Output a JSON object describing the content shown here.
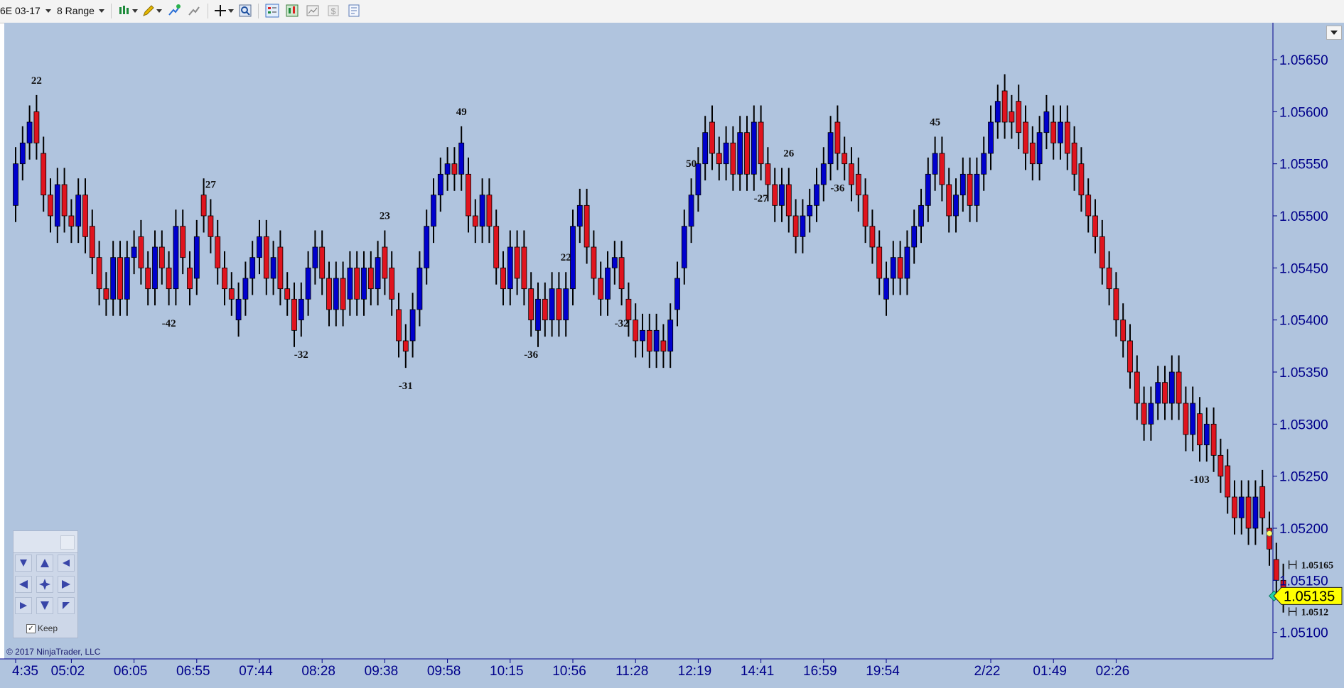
{
  "toolbar": {
    "instrument": "6E 03-17",
    "bar_type": "8 Range",
    "icons": [
      "bar-style-icon",
      "drawing-tools-icon",
      "add-indicator-icon",
      "strategies-icon",
      "crosshair-icon",
      "zoom-icon",
      "chart-trader-icon",
      "data-box-icon",
      "templates-icon",
      "dollar-icon",
      "properties-icon"
    ]
  },
  "chart": {
    "colors": {
      "background": "#b0c4de",
      "up_bar": "#0000cd",
      "down_bar": "#e0141e",
      "wick": "#000000",
      "axis": "#00008b",
      "price_marker": "#ffff00"
    },
    "price_axis": {
      "min": 1.0508,
      "max": 1.0568,
      "ticks": [
        "1.05650",
        "1.05600",
        "1.05550",
        "1.05500",
        "1.05450",
        "1.05400",
        "1.05350",
        "1.05300",
        "1.05250",
        "1.05200",
        "1.05150",
        "1.05100"
      ]
    },
    "time_axis": {
      "labels": [
        {
          "label": "4:35",
          "bar": 0
        },
        {
          "label": "05:02",
          "bar": 8
        },
        {
          "label": "06:05",
          "bar": 17
        },
        {
          "label": "06:55",
          "bar": 26
        },
        {
          "label": "07:44",
          "bar": 35
        },
        {
          "label": "08:28",
          "bar": 44
        },
        {
          "label": "09:38",
          "bar": 53
        },
        {
          "label": "09:58",
          "bar": 62
        },
        {
          "label": "10:15",
          "bar": 71
        },
        {
          "label": "10:56",
          "bar": 80
        },
        {
          "label": "11:28",
          "bar": 89
        },
        {
          "label": "12:19",
          "bar": 98
        },
        {
          "label": "14:41",
          "bar": 107
        },
        {
          "label": "16:59",
          "bar": 116
        },
        {
          "label": "19:54",
          "bar": 125
        },
        {
          "label": "2/22",
          "bar": 140
        },
        {
          "label": "01:49",
          "bar": 149
        },
        {
          "label": "02:26",
          "bar": 158
        }
      ]
    },
    "bars": [
      {
        "o": 1.0551,
        "c": 1.0555
      },
      {
        "o": 1.0555,
        "c": 1.0557
      },
      {
        "o": 1.0557,
        "c": 1.0559
      },
      {
        "o": 1.056,
        "c": 1.0557
      },
      {
        "o": 1.0556,
        "c": 1.0552
      },
      {
        "o": 1.0552,
        "c": 1.055
      },
      {
        "o": 1.0549,
        "c": 1.0553
      },
      {
        "o": 1.0553,
        "c": 1.055
      },
      {
        "o": 1.055,
        "c": 1.0549
      },
      {
        "o": 1.0549,
        "c": 1.0552
      },
      {
        "o": 1.0552,
        "c": 1.0548
      },
      {
        "o": 1.0549,
        "c": 1.0546
      },
      {
        "o": 1.0546,
        "c": 1.0543
      },
      {
        "o": 1.0543,
        "c": 1.0542
      },
      {
        "o": 1.0542,
        "c": 1.0546
      },
      {
        "o": 1.0546,
        "c": 1.0542
      },
      {
        "o": 1.0542,
        "c": 1.0546
      },
      {
        "o": 1.0546,
        "c": 1.0547
      },
      {
        "o": 1.0548,
        "c": 1.0545
      },
      {
        "o": 1.0545,
        "c": 1.0543
      },
      {
        "o": 1.0543,
        "c": 1.0547
      },
      {
        "o": 1.0547,
        "c": 1.0545
      },
      {
        "o": 1.0545,
        "c": 1.0543
      },
      {
        "o": 1.0543,
        "c": 1.0549
      },
      {
        "o": 1.0549,
        "c": 1.0546
      },
      {
        "o": 1.0545,
        "c": 1.0543
      },
      {
        "o": 1.0544,
        "c": 1.0548
      },
      {
        "o": 1.0552,
        "c": 1.055
      },
      {
        "o": 1.055,
        "c": 1.0548
      },
      {
        "o": 1.0548,
        "c": 1.0545
      },
      {
        "o": 1.0545,
        "c": 1.0543
      },
      {
        "o": 1.0543,
        "c": 1.0542
      },
      {
        "o": 1.054,
        "c": 1.0542
      },
      {
        "o": 1.0542,
        "c": 1.0544
      },
      {
        "o": 1.0544,
        "c": 1.0546
      },
      {
        "o": 1.0546,
        "c": 1.0548
      },
      {
        "o": 1.0548,
        "c": 1.0544
      },
      {
        "o": 1.0544,
        "c": 1.0546
      },
      {
        "o": 1.0547,
        "c": 1.0543
      },
      {
        "o": 1.0543,
        "c": 1.0542
      },
      {
        "o": 1.0542,
        "c": 1.0539
      },
      {
        "o": 1.054,
        "c": 1.0542
      },
      {
        "o": 1.0542,
        "c": 1.0545
      },
      {
        "o": 1.0545,
        "c": 1.0547
      },
      {
        "o": 1.0547,
        "c": 1.0544
      },
      {
        "o": 1.0544,
        "c": 1.0541
      },
      {
        "o": 1.0541,
        "c": 1.0544
      },
      {
        "o": 1.0544,
        "c": 1.0541
      },
      {
        "o": 1.0542,
        "c": 1.0545
      },
      {
        "o": 1.0545,
        "c": 1.0542
      },
      {
        "o": 1.0542,
        "c": 1.0545
      },
      {
        "o": 1.0545,
        "c": 1.0543
      },
      {
        "o": 1.0543,
        "c": 1.0546
      },
      {
        "o": 1.0547,
        "c": 1.0544
      },
      {
        "o": 1.0545,
        "c": 1.0542
      },
      {
        "o": 1.0541,
        "c": 1.0538
      },
      {
        "o": 1.0538,
        "c": 1.0537
      },
      {
        "o": 1.0538,
        "c": 1.0541
      },
      {
        "o": 1.0541,
        "c": 1.0545
      },
      {
        "o": 1.0545,
        "c": 1.0549
      },
      {
        "o": 1.0549,
        "c": 1.0552
      },
      {
        "o": 1.0552,
        "c": 1.0554
      },
      {
        "o": 1.0554,
        "c": 1.0555
      },
      {
        "o": 1.0555,
        "c": 1.0554
      },
      {
        "o": 1.0554,
        "c": 1.0557
      },
      {
        "o": 1.0554,
        "c": 1.055
      },
      {
        "o": 1.055,
        "c": 1.0549
      },
      {
        "o": 1.0549,
        "c": 1.0552
      },
      {
        "o": 1.0552,
        "c": 1.0549
      },
      {
        "o": 1.0549,
        "c": 1.0545
      },
      {
        "o": 1.0545,
        "c": 1.0543
      },
      {
        "o": 1.0543,
        "c": 1.0547
      },
      {
        "o": 1.0547,
        "c": 1.0544
      },
      {
        "o": 1.0547,
        "c": 1.0543
      },
      {
        "o": 1.0543,
        "c": 1.054
      },
      {
        "o": 1.0539,
        "c": 1.0542
      },
      {
        "o": 1.0542,
        "c": 1.054
      },
      {
        "o": 1.054,
        "c": 1.0543
      },
      {
        "o": 1.0543,
        "c": 1.054
      },
      {
        "o": 1.054,
        "c": 1.0543
      },
      {
        "o": 1.0543,
        "c": 1.0549
      },
      {
        "o": 1.0549,
        "c": 1.0551
      },
      {
        "o": 1.0551,
        "c": 1.0547
      },
      {
        "o": 1.0547,
        "c": 1.0544
      },
      {
        "o": 1.0544,
        "c": 1.0542
      },
      {
        "o": 1.0542,
        "c": 1.0545
      },
      {
        "o": 1.0545,
        "c": 1.0546
      },
      {
        "o": 1.0546,
        "c": 1.0543
      },
      {
        "o": 1.0542,
        "c": 1.054
      },
      {
        "o": 1.054,
        "c": 1.0538
      },
      {
        "o": 1.0538,
        "c": 1.0539
      },
      {
        "o": 1.0539,
        "c": 1.0537
      },
      {
        "o": 1.0537,
        "c": 1.0539
      },
      {
        "o": 1.0538,
        "c": 1.0537
      },
      {
        "o": 1.0537,
        "c": 1.054
      },
      {
        "o": 1.0541,
        "c": 1.0544
      },
      {
        "o": 1.0545,
        "c": 1.0549
      },
      {
        "o": 1.0549,
        "c": 1.0552
      },
      {
        "o": 1.0552,
        "c": 1.0555
      },
      {
        "o": 1.0555,
        "c": 1.0558
      },
      {
        "o": 1.0559,
        "c": 1.0556
      },
      {
        "o": 1.0556,
        "c": 1.0555
      },
      {
        "o": 1.0555,
        "c": 1.0557
      },
      {
        "o": 1.0557,
        "c": 1.0554
      },
      {
        "o": 1.0554,
        "c": 1.0558
      },
      {
        "o": 1.0558,
        "c": 1.0554
      },
      {
        "o": 1.0554,
        "c": 1.0559
      },
      {
        "o": 1.0559,
        "c": 1.0555
      },
      {
        "o": 1.0555,
        "c": 1.0553
      },
      {
        "o": 1.0553,
        "c": 1.0551
      },
      {
        "o": 1.0551,
        "c": 1.0553
      },
      {
        "o": 1.0553,
        "c": 1.055
      },
      {
        "o": 1.055,
        "c": 1.0548
      },
      {
        "o": 1.0548,
        "c": 1.055
      },
      {
        "o": 1.055,
        "c": 1.0551
      },
      {
        "o": 1.0551,
        "c": 1.0553
      },
      {
        "o": 1.0553,
        "c": 1.0555
      },
      {
        "o": 1.0555,
        "c": 1.0558
      },
      {
        "o": 1.0559,
        "c": 1.0556
      },
      {
        "o": 1.0556,
        "c": 1.0555
      },
      {
        "o": 1.0555,
        "c": 1.0553
      },
      {
        "o": 1.0554,
        "c": 1.0552
      },
      {
        "o": 1.0552,
        "c": 1.0549
      },
      {
        "o": 1.0549,
        "c": 1.0547
      },
      {
        "o": 1.0547,
        "c": 1.0544
      },
      {
        "o": 1.0542,
        "c": 1.0544
      },
      {
        "o": 1.0544,
        "c": 1.0546
      },
      {
        "o": 1.0546,
        "c": 1.0544
      },
      {
        "o": 1.0544,
        "c": 1.0547
      },
      {
        "o": 1.0547,
        "c": 1.0549
      },
      {
        "o": 1.0549,
        "c": 1.0551
      },
      {
        "o": 1.0551,
        "c": 1.0554
      },
      {
        "o": 1.0554,
        "c": 1.0556
      },
      {
        "o": 1.0556,
        "c": 1.0553
      },
      {
        "o": 1.0553,
        "c": 1.055
      },
      {
        "o": 1.055,
        "c": 1.0552
      },
      {
        "o": 1.0552,
        "c": 1.0554
      },
      {
        "o": 1.0554,
        "c": 1.0551
      },
      {
        "o": 1.0551,
        "c": 1.0554
      },
      {
        "o": 1.0554,
        "c": 1.0556
      },
      {
        "o": 1.0556,
        "c": 1.0559
      },
      {
        "o": 1.0559,
        "c": 1.0561
      },
      {
        "o": 1.0562,
        "c": 1.0559
      },
      {
        "o": 1.056,
        "c": 1.0559
      },
      {
        "o": 1.0561,
        "c": 1.0558
      },
      {
        "o": 1.0559,
        "c": 1.0556
      },
      {
        "o": 1.0557,
        "c": 1.0555
      },
      {
        "o": 1.0555,
        "c": 1.0558
      },
      {
        "o": 1.0558,
        "c": 1.056
      },
      {
        "o": 1.0559,
        "c": 1.0557
      },
      {
        "o": 1.0557,
        "c": 1.0559
      },
      {
        "o": 1.0559,
        "c": 1.0556
      },
      {
        "o": 1.0557,
        "c": 1.0554
      },
      {
        "o": 1.0555,
        "c": 1.0552
      },
      {
        "o": 1.0552,
        "c": 1.055
      },
      {
        "o": 1.055,
        "c": 1.0548
      },
      {
        "o": 1.0548,
        "c": 1.0545
      },
      {
        "o": 1.0545,
        "c": 1.0543
      },
      {
        "o": 1.0543,
        "c": 1.054
      },
      {
        "o": 1.054,
        "c": 1.0538
      },
      {
        "o": 1.0538,
        "c": 1.0535
      },
      {
        "o": 1.0535,
        "c": 1.0532
      },
      {
        "o": 1.0532,
        "c": 1.053
      },
      {
        "o": 1.053,
        "c": 1.0532
      },
      {
        "o": 1.0532,
        "c": 1.0534
      },
      {
        "o": 1.0534,
        "c": 1.0532
      },
      {
        "o": 1.0532,
        "c": 1.0535
      },
      {
        "o": 1.0535,
        "c": 1.0532
      },
      {
        "o": 1.0532,
        "c": 1.0529
      },
      {
        "o": 1.0529,
        "c": 1.0532
      },
      {
        "o": 1.0531,
        "c": 1.0528
      },
      {
        "o": 1.0528,
        "c": 1.053
      },
      {
        "o": 1.053,
        "c": 1.0527
      },
      {
        "o": 1.0527,
        "c": 1.0525
      },
      {
        "o": 1.0526,
        "c": 1.0523
      },
      {
        "o": 1.0523,
        "c": 1.0521
      },
      {
        "o": 1.0521,
        "c": 1.0523
      },
      {
        "o": 1.0523,
        "c": 1.052
      },
      {
        "o": 1.052,
        "c": 1.0523
      },
      {
        "o": 1.0524,
        "c": 1.0521
      },
      {
        "o": 1.052,
        "c": 1.0518
      },
      {
        "o": 1.0517,
        "c": 1.0515
      },
      {
        "o": 1.0515,
        "c": 1.05135
      }
    ],
    "swing_labels": [
      {
        "bar": 3,
        "text": "22",
        "position": "high"
      },
      {
        "bar": 22,
        "text": "-42",
        "position": "low"
      },
      {
        "bar": 28,
        "text": "27",
        "position": "high"
      },
      {
        "bar": 41,
        "text": "-32",
        "position": "low"
      },
      {
        "bar": 53,
        "text": "23",
        "position": "high"
      },
      {
        "bar": 56,
        "text": "-31",
        "position": "low"
      },
      {
        "bar": 64,
        "text": "49",
        "position": "high"
      },
      {
        "bar": 74,
        "text": "-36",
        "position": "low"
      },
      {
        "bar": 79,
        "text": "22",
        "position": "high"
      },
      {
        "bar": 87,
        "text": "-32",
        "position": "low"
      },
      {
        "bar": 97,
        "text": "50",
        "position": "high"
      },
      {
        "bar": 107,
        "text": "-27",
        "position": "low"
      },
      {
        "bar": 111,
        "text": "26",
        "position": "high"
      },
      {
        "bar": 118,
        "text": "-36",
        "position": "low"
      },
      {
        "bar": 132,
        "text": "45",
        "position": "high"
      },
      {
        "bar": 170,
        "text": "-103",
        "position": "low"
      }
    ],
    "range_markers": {
      "high_price": "1.05165",
      "low_price": "1.0512"
    },
    "current_price": "1.05135",
    "copyright": "© 2017 NinjaTrader, LLC"
  },
  "navigator": {
    "keep_label": "Keep",
    "keep_checked": true
  }
}
